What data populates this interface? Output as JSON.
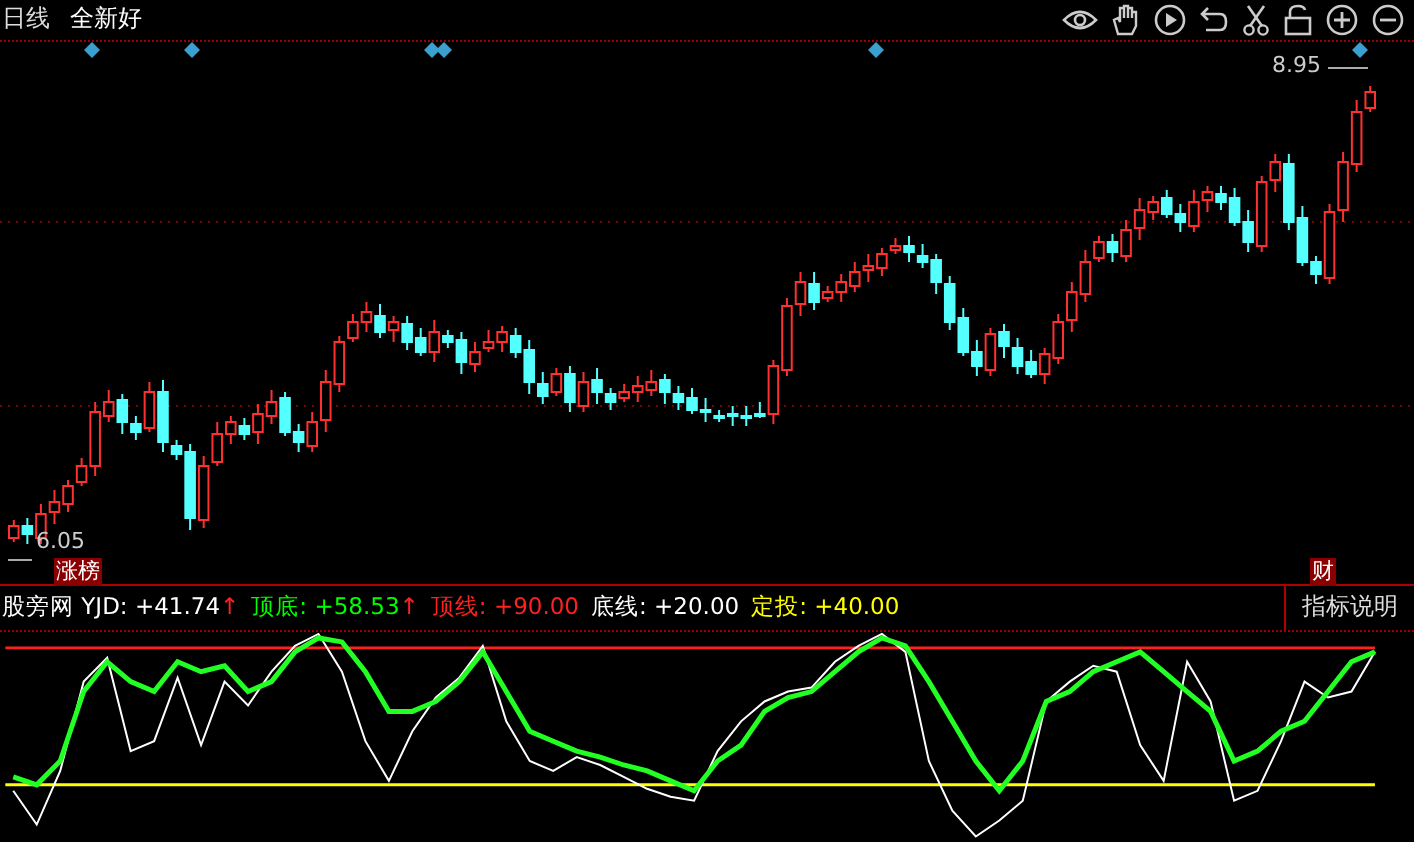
{
  "top_bar": {
    "period": "日线",
    "stock_name": "全新好"
  },
  "price_labels": {
    "high": "8.95",
    "low": "6.05"
  },
  "badges": [
    {
      "text": "涨榜"
    },
    {
      "text": "财"
    }
  ],
  "indicator": {
    "items": [
      {
        "label": "股旁网 YJD:",
        "value": "+41.74",
        "arrow": "↑",
        "color": "#ffffff"
      },
      {
        "label": "顶底:",
        "value": "+58.53",
        "arrow": "↑",
        "color": "#00ff00"
      },
      {
        "label": "顶线:",
        "value": "+90.00",
        "color": "#ff2020"
      },
      {
        "label": "底线:",
        "value": "+20.00",
        "color": "#ffffff"
      },
      {
        "label": "定投:",
        "value": "+40.00",
        "color": "#ffff00"
      }
    ],
    "button": "指标说明"
  }
}
